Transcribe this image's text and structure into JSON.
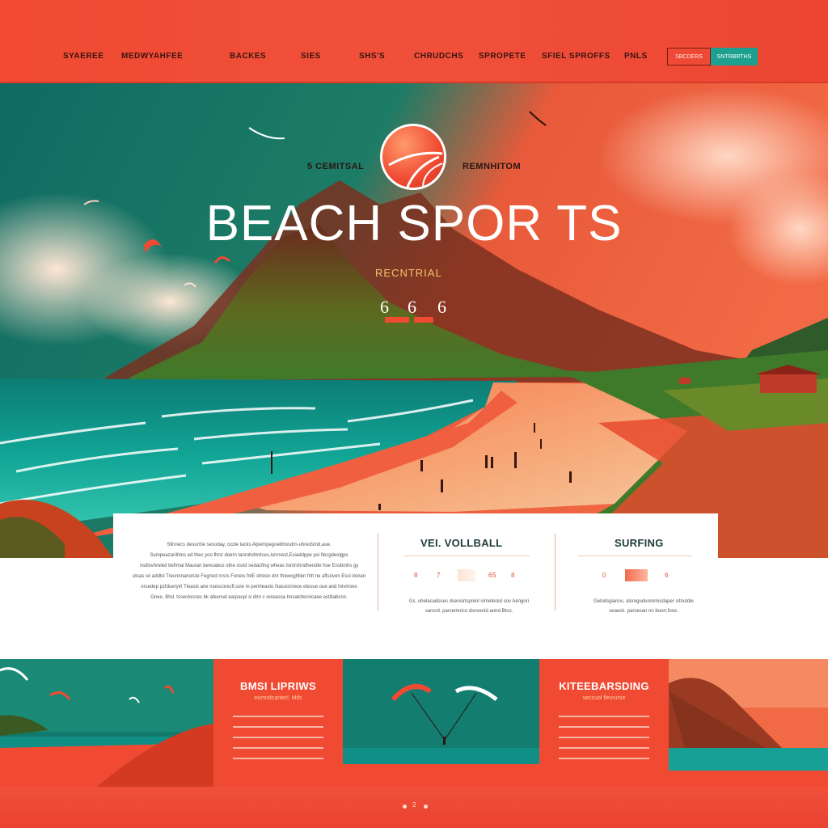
{
  "nav": {
    "items": [
      "SYAEREE",
      "MEDWYAHFEE",
      "BACKES",
      "SIES",
      "SHS'S",
      "CHRUDCHS",
      "SPROPETE",
      "SFIEL SPROFFS",
      "PNLS"
    ],
    "button_outline": "SBCDERS",
    "button_solid": "SNTRBRTHS",
    "colors": {
      "bar": "#f04a32",
      "cta": "#1da08f"
    }
  },
  "hero": {
    "tag_left": "5 CEMITSAL",
    "tag_right": "REMNHITOM",
    "title": "BEACH SPOR TS",
    "subtitle": "RECNTRIAL",
    "numbers": [
      "6",
      "6",
      "6"
    ],
    "logo_icon": "volleyball-icon"
  },
  "info": {
    "paragraph": [
      "Sllnnecs desurrtie sesoday, cicde tacks Alpernpegoebhosdrn-uhredstnd,aue.",
      "Sumpeazarithins ed thec yoo fhnz doern tanrohdnrdces,lonrnest,Esiaddppe psi flecgdeolgps",
      "nsdlsvhreled befimai Mauran benoabos othe osnd sedacfing  wheas lsintrshndhendte hse Ensbinhs gy",
      "otsas sn addlsl Trecnnnanonze Fegnod nrsrs Foneis fnlE shlosn dnr thewoghllen fnlt ne aftsovon Essl donan",
      "orsedep pzfdueryirt Tieasls ane nsescorecfl,ssie m penheasto Nasocinrece etesue oue and Inivmses",
      "Gneo. Bhd. tssenlocnes bk alkernal earpaspl si dlrn c rereasoa hnsalcltenricaee estlliabcnn."
    ],
    "volleyball": {
      "title": "VEI. VOLLBALL",
      "stats": [
        "8",
        "7",
        "6S",
        "8"
      ],
      "caption": [
        "Gs. uhelacadoces  dsensirlsprenl sirnetered sov Aengori",
        "sansrd. parcemnico dsnvenid annd Btco."
      ]
    },
    "surfing": {
      "title": "SURFING",
      "stats": [
        "0",
        "6"
      ],
      "caption": [
        "Gelodsgianos. alsregudurenmicdaper sitnutdie",
        "seaeck. parsesan nn boorr,fose."
      ]
    }
  },
  "gallery": {
    "promo_left": {
      "title": "BMSI LIPRIWS",
      "subtitle": "eomndcanterl. Mtls"
    },
    "promo_right": {
      "title": "KITEEBARSDING",
      "subtitle": "seccuol flesrurse"
    },
    "scenes": [
      "kites-beach-scene",
      "kitesurfer-scene",
      "coast-cliff-scene"
    ]
  },
  "footer": {
    "pager_label": "2"
  }
}
